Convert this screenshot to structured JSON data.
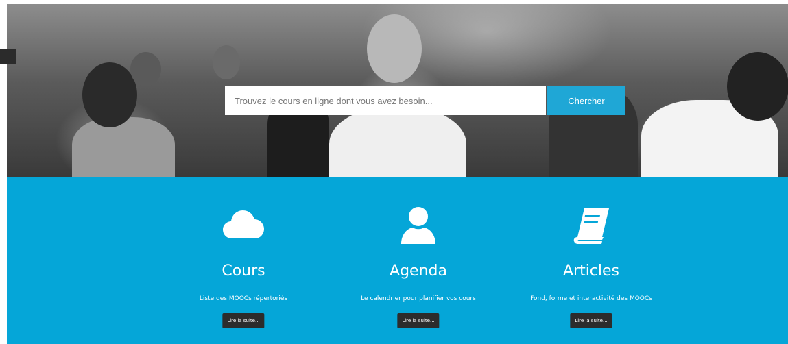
{
  "search": {
    "placeholder": "Trouvez le cours en ligne dont vous avez besoin...",
    "value": "",
    "button_label": "Chercher"
  },
  "features": [
    {
      "icon": "cloud-icon",
      "title": "Cours",
      "description": "Liste des MOOCs répertoriés",
      "button_label": "Lire la suite..."
    },
    {
      "icon": "user-icon",
      "title": "Agenda",
      "description": "Le calendrier pour planifier vos cours",
      "button_label": "Lire la suite..."
    },
    {
      "icon": "book-icon",
      "title": "Articles",
      "description": "Fond, forme et interactivité des MOOCs",
      "button_label": "Lire la suite..."
    }
  ],
  "colors": {
    "accent": "#05a6d8",
    "search_button": "#1fa7d6",
    "read_more_button": "#2c2c2c"
  }
}
